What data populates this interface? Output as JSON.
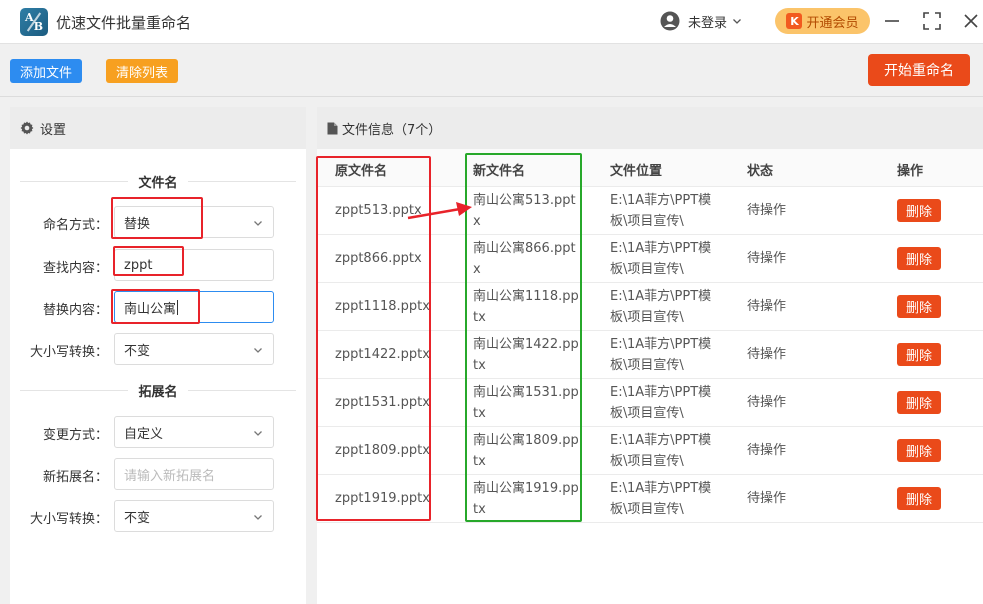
{
  "app": {
    "title": "优速文件批量重命名",
    "logo_a": "A",
    "logo_b": "B"
  },
  "header": {
    "user_label": "未登录",
    "vip_label": "开通会员",
    "vip_icon_text": "K"
  },
  "toolbar": {
    "add_label": "添加文件",
    "clear_label": "清除列表",
    "start_label": "开始重命名"
  },
  "settings": {
    "header": "设置",
    "filename_section": "文件名",
    "naming_mode_label": "命名方式：",
    "naming_mode_value": "替换",
    "find_label": "查找内容：",
    "find_value": "zppt",
    "replace_label": "替换内容：",
    "replace_value": "南山公寓",
    "case_label": "大小写转换：",
    "case_value": "不变",
    "ext_section": "拓展名",
    "ext_mode_label": "变更方式：",
    "ext_mode_value": "自定义",
    "new_ext_label": "新拓展名：",
    "new_ext_placeholder": "请输入新拓展名",
    "ext_case_label": "大小写转换：",
    "ext_case_value": "不变"
  },
  "files": {
    "header": "文件信息（7个）",
    "columns": {
      "orig": "原文件名",
      "new": "新文件名",
      "path": "文件位置",
      "status": "状态",
      "action": "操作"
    },
    "delete_label": "删除",
    "rows": [
      {
        "orig": "zppt513.pptx",
        "new": "南山公寓513.pptx",
        "path": "E:\\1A菲方\\PPT模板\\项目宣传\\",
        "status": "待操作"
      },
      {
        "orig": "zppt866.pptx",
        "new": "南山公寓866.pptx",
        "path": "E:\\1A菲方\\PPT模板\\项目宣传\\",
        "status": "待操作"
      },
      {
        "orig": "zppt1118.pptx",
        "new": "南山公寓1118.pptx",
        "path": "E:\\1A菲方\\PPT模板\\项目宣传\\",
        "status": "待操作"
      },
      {
        "orig": "zppt1422.pptx",
        "new": "南山公寓1422.pptx",
        "path": "E:\\1A菲方\\PPT模板\\项目宣传\\",
        "status": "待操作"
      },
      {
        "orig": "zppt1531.pptx",
        "new": "南山公寓1531.pptx",
        "path": "E:\\1A菲方\\PPT模板\\项目宣传\\",
        "status": "待操作"
      },
      {
        "orig": "zppt1809.pptx",
        "new": "南山公寓1809.pptx",
        "path": "E:\\1A菲方\\PPT模板\\项目宣传\\",
        "status": "待操作"
      },
      {
        "orig": "zppt1919.pptx",
        "new": "南山公寓1919.pptx",
        "path": "E:\\1A菲方\\PPT模板\\项目宣传\\",
        "status": "待操作"
      }
    ]
  },
  "colors": {
    "primary_blue": "#2d8cf0",
    "orange": "#f7a020",
    "danger": "#ea4a1a",
    "annotation_red": "#e8232a",
    "annotation_green": "#27a82a"
  }
}
